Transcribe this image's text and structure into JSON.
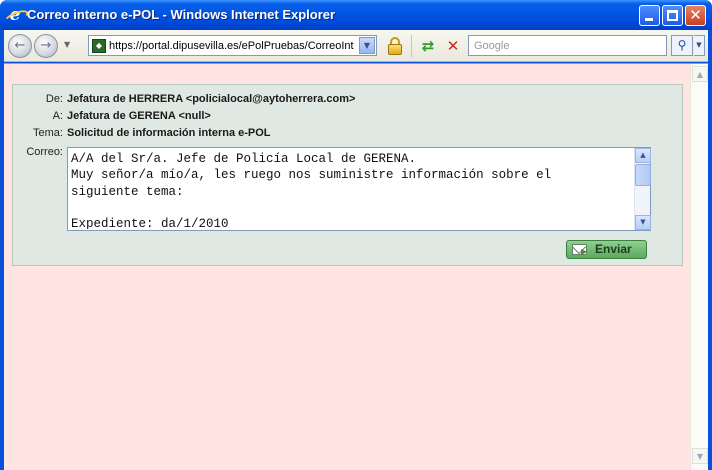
{
  "window": {
    "title": "Correo interno e-POL - Windows Internet Explorer",
    "close_glyph": "✕"
  },
  "toolbar": {
    "back_glyph": "←",
    "forward_glyph": "→",
    "address_url": "https://portal.dipusevilla.es/ePolPruebas/CorreoInterno",
    "search_placeholder": "Google",
    "search_icon": "search-icon",
    "refresh_glyph": "⇄",
    "stop_glyph": "✕"
  },
  "form": {
    "from_label": "De:",
    "from_value": "Jefatura de HERRERA <policialocal@aytoherrera.com>",
    "to_label": "A:",
    "to_value": "Jefatura de GERENA <null>",
    "subject_label": "Tema:",
    "subject_value": "Solicitud de información interna e-POL",
    "body_label": "Correo:",
    "body_text": "A/A del Sr/a. Jefe de Policía Local de GERENA.\nMuy señor/a mío/a, les ruego nos suministre información sobre el\nsiguiente tema:\n\nExpediente: da/1/2010",
    "send_label": "Enviar"
  },
  "colors": {
    "page_background": "#ffe4e2",
    "panel_background": "#dfe8e2",
    "send_button": "#6fbf73"
  }
}
